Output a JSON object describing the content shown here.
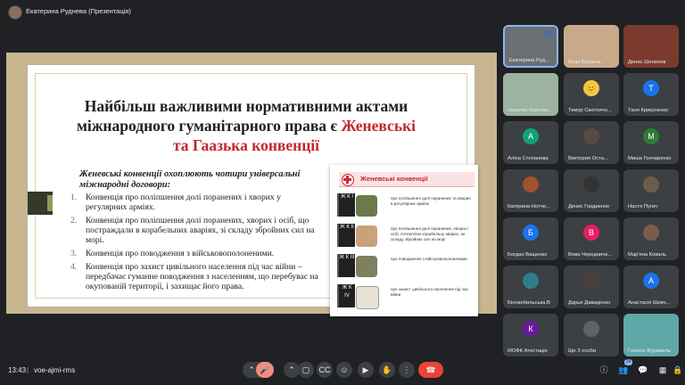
{
  "meeting": {
    "presenter_label": "Екатерина Руднева (Презентація)",
    "time": "13:43",
    "separator": "|",
    "code": "voe-ajmi-rms",
    "participant_count": "24"
  },
  "slide": {
    "title_part1": "Найбільш важливими нормативними актами міжнародного гуманітарного права є ",
    "title_highlight": "Женевські та Гаазька конвенції",
    "intro": "Женевські конвенції охоплюють чотири універсальні міжнародні договори:",
    "items": [
      {
        "num": "1.",
        "text": "Конвенція про поліпшення долі поранених і хворих у регулярних арміях."
      },
      {
        "num": "2.",
        "text": "Конвенція про поліпшення долі поранених, хворих і осіб, що постраждали в корабельних аваріях, зі складу збройних сил на морі."
      },
      {
        "num": "3.",
        "text": "Конвенція про поводження з військовополоненими."
      },
      {
        "num": "4.",
        "text": "Конвенція про захист цивільного населення під час війни – передбачає гуманне поводження з населенням, що перебуває на окупованій території, і захищає його права."
      }
    ],
    "card": {
      "title": "Женевські конвенції",
      "rows": [
        {
          "book": "Ж К I",
          "text": "про поліпшення долі поранених та хворих в регулярних арміях"
        },
        {
          "book": "Ж К II",
          "text": "про поліпшення долі поранених, хворих і осіб, потерпілих корабельну аварію, зи складу збройних сил на морі"
        },
        {
          "book": "Ж К III",
          "text": "про поводження з військовополоненими"
        },
        {
          "book": "Ж К IV",
          "text": "про захист цивільного населення під час війни"
        }
      ]
    }
  },
  "participants": [
    {
      "name": "Екатерина Руд...",
      "kind": "photo",
      "color": "#6b6f73",
      "active": true
    },
    {
      "name": "Юлія Білокінь",
      "kind": "photo",
      "color": "#c8a98a"
    },
    {
      "name": "Денис Шепелев",
      "kind": "photo",
      "color": "#7a3b2e"
    },
    {
      "name": "Наталка Максим...",
      "kind": "photo",
      "color": "#9bb3a0"
    },
    {
      "name": "Тимур Светличн...",
      "kind": "avatar",
      "letter": "😊",
      "color": "#f2c94c"
    },
    {
      "name": "Таня Крикуненко",
      "kind": "avatar",
      "letter": "Т",
      "color": "#1a73e8"
    },
    {
      "name": "Аліна Степанова",
      "kind": "avatar",
      "letter": "А",
      "color": "#12a07a"
    },
    {
      "name": "Виктория Оста...",
      "kind": "avatar",
      "letter": "",
      "color": "#5a4a44"
    },
    {
      "name": "Миша Гончаренко",
      "kind": "avatar",
      "letter": "М",
      "color": "#2e7d32"
    },
    {
      "name": "Катерина Нотче...",
      "kind": "avatar",
      "letter": "",
      "color": "#a0522d"
    },
    {
      "name": "Денис Гордиенко",
      "kind": "avatar",
      "letter": "",
      "color": "#333333"
    },
    {
      "name": "Настя Пугач",
      "kind": "avatar",
      "letter": "",
      "color": "#6d5c4c"
    },
    {
      "name": "Богдан Ващенко",
      "kind": "avatar",
      "letter": "Б",
      "color": "#1a73e8"
    },
    {
      "name": "Вова Чередниче...",
      "kind": "avatar",
      "letter": "В",
      "color": "#e91e63"
    },
    {
      "name": "Мар'яна Коваль",
      "kind": "avatar",
      "letter": "",
      "color": "#7b5b4b"
    },
    {
      "name": "Білокобильська.В",
      "kind": "avatar",
      "letter": "",
      "color": "#2e7d8a"
    },
    {
      "name": "Дарья Давиденко",
      "kind": "avatar",
      "letter": "",
      "color": "#4a3f38"
    },
    {
      "name": "Анастасія Шевч...",
      "kind": "avatar",
      "letter": "А",
      "color": "#1a73e8"
    },
    {
      "name": "КЮФК Атестація",
      "kind": "avatar",
      "letter": "К",
      "color": "#6a1b9a"
    },
    {
      "name": "Ще 3 особи",
      "kind": "avatar",
      "letter": "",
      "color": "#5f6368"
    },
    {
      "name": "Галина Журавель",
      "kind": "photo",
      "color": "#5fa8a8"
    }
  ],
  "controls": {
    "mic_off": "🎤",
    "captions": "CC",
    "emoji": "☺",
    "present": "▶",
    "hand": "✋",
    "more": "⋮",
    "end": "☎",
    "info": "ⓘ",
    "people": "👥",
    "chat": "💬",
    "activities": "▦",
    "lock": "🔒"
  }
}
